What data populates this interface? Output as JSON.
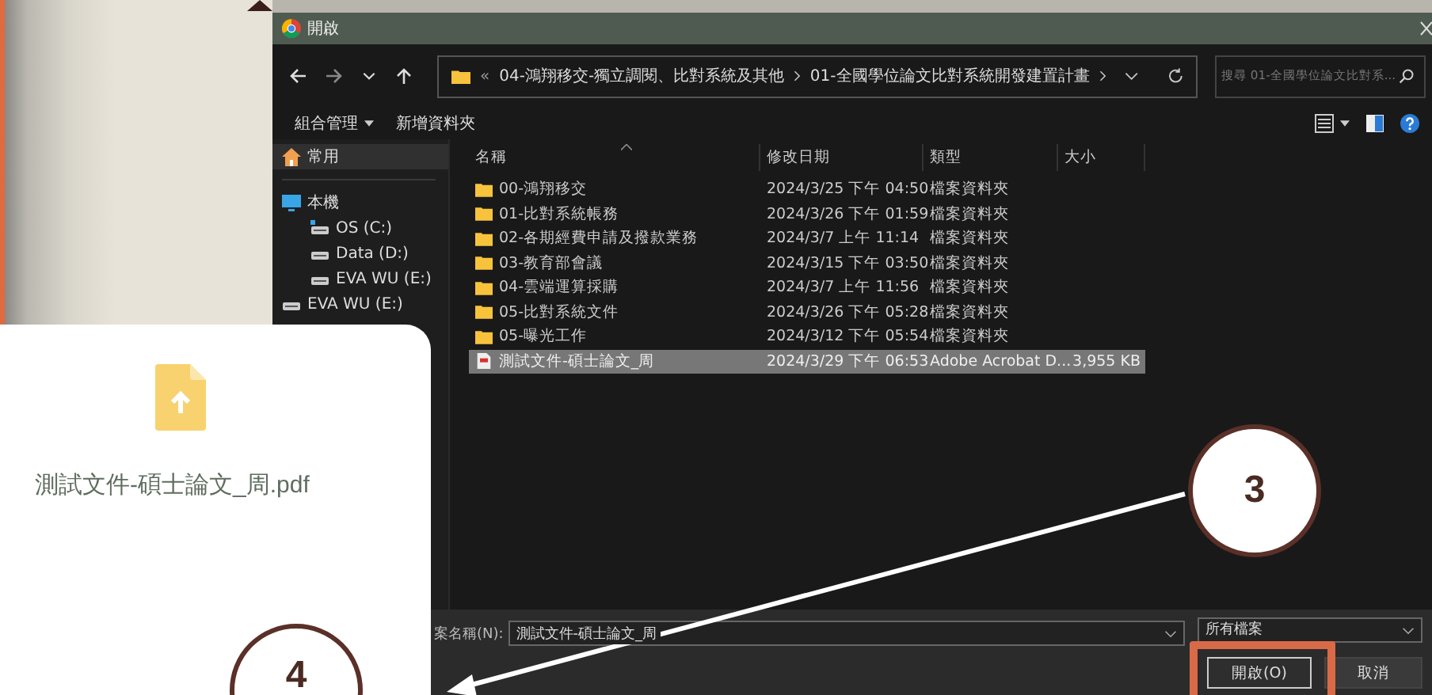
{
  "dialog": {
    "title": "開啟",
    "address": {
      "overflow": "«",
      "segments": [
        "04-鴻翔移交-獨立調閱、比對系統及其他",
        "01-全國學位論文比對系統開發建置計畫"
      ]
    },
    "search": {
      "placeholder": "搜尋 01-全國學位論文比對系..."
    },
    "toolbar": {
      "organize": "組合管理",
      "new_folder": "新增資料夾"
    },
    "sidebar": {
      "items": [
        {
          "label": "常用",
          "kind": "home",
          "selected": true
        },
        {
          "label": "本機",
          "kind": "pc",
          "selected": false,
          "children": [
            {
              "label": "OS (C:)",
              "kind": "os-drive",
              "selected": false
            },
            {
              "label": "Data (D:)",
              "kind": "drive",
              "selected": false
            },
            {
              "label": "EVA WU (E:)",
              "kind": "drive",
              "selected": false
            }
          ]
        },
        {
          "label": "EVA WU (E:)",
          "kind": "drive",
          "selected": false
        }
      ]
    },
    "columns": [
      "名稱",
      "修改日期",
      "類型",
      "大小"
    ],
    "rows": [
      {
        "kind": "folder",
        "name": "00-鴻翔移交",
        "date": "2024/3/25 下午 04:50",
        "type": "檔案資料夾",
        "selected": false
      },
      {
        "kind": "folder",
        "name": "01-比對系統帳務",
        "date": "2024/3/26 下午 01:59",
        "type": "檔案資料夾",
        "selected": false
      },
      {
        "kind": "folder",
        "name": "02-各期經費申請及撥款業務",
        "date": "2024/3/7 上午 11:14",
        "type": "檔案資料夾",
        "selected": false
      },
      {
        "kind": "folder",
        "name": "03-教育部會議",
        "date": "2024/3/15 下午 03:50",
        "type": "檔案資料夾",
        "selected": false
      },
      {
        "kind": "folder",
        "name": "04-雲端運算採購",
        "date": "2024/3/7 上午 11:56",
        "type": "檔案資料夾",
        "selected": false
      },
      {
        "kind": "folder",
        "name": "05-比對系統文件",
        "date": "2024/3/26 下午 05:28",
        "type": "檔案資料夾",
        "selected": false
      },
      {
        "kind": "folder",
        "name": "05-曝光工作",
        "date": "2024/3/12 下午 05:54",
        "type": "檔案資料夾",
        "selected": false
      },
      {
        "kind": "pdf",
        "name": "測試文件-碩士論文_周",
        "date": "2024/3/29 下午 06:53",
        "type": "Adobe Acrobat D...",
        "size": "3,955 KB",
        "selected": true
      }
    ],
    "filename_label": "案名稱(N):",
    "filename": "測試文件-碩士論文_周",
    "filetype": "所有檔案",
    "buttons": [
      "開啟(O)",
      "取消"
    ]
  },
  "upload_card": {
    "filename": "測試文件-碩士論文_周.pdf"
  },
  "markers": [
    {
      "label": "3"
    },
    {
      "label": "4"
    }
  ]
}
